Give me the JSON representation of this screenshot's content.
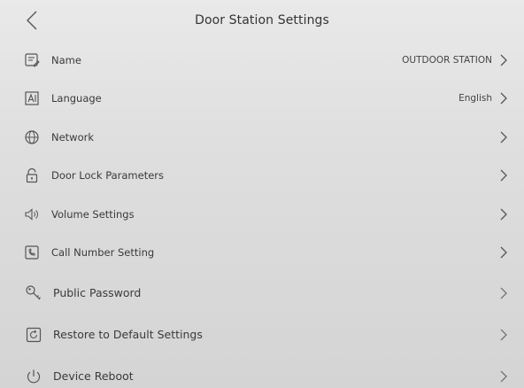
{
  "header": {
    "title": "Door Station Settings"
  },
  "items": [
    {
      "label": "Name",
      "value": "OUTDOOR STATION",
      "icon": "name-tag-icon"
    },
    {
      "label": "Language",
      "value": "English",
      "icon": "language-icon"
    },
    {
      "label": "Network",
      "value": "",
      "icon": "globe-icon"
    },
    {
      "label": "Door Lock Parameters",
      "value": "",
      "icon": "lock-icon"
    },
    {
      "label": "Volume Settings",
      "value": "",
      "icon": "speaker-icon"
    },
    {
      "label": "Call Number Setting",
      "value": "",
      "icon": "call-number-icon"
    },
    {
      "label": "Public Password",
      "value": "",
      "icon": "key-icon"
    },
    {
      "label": "Restore to Default Settings",
      "value": "",
      "icon": "restore-icon"
    },
    {
      "label": "Device Reboot",
      "value": "",
      "icon": "power-icon"
    }
  ]
}
